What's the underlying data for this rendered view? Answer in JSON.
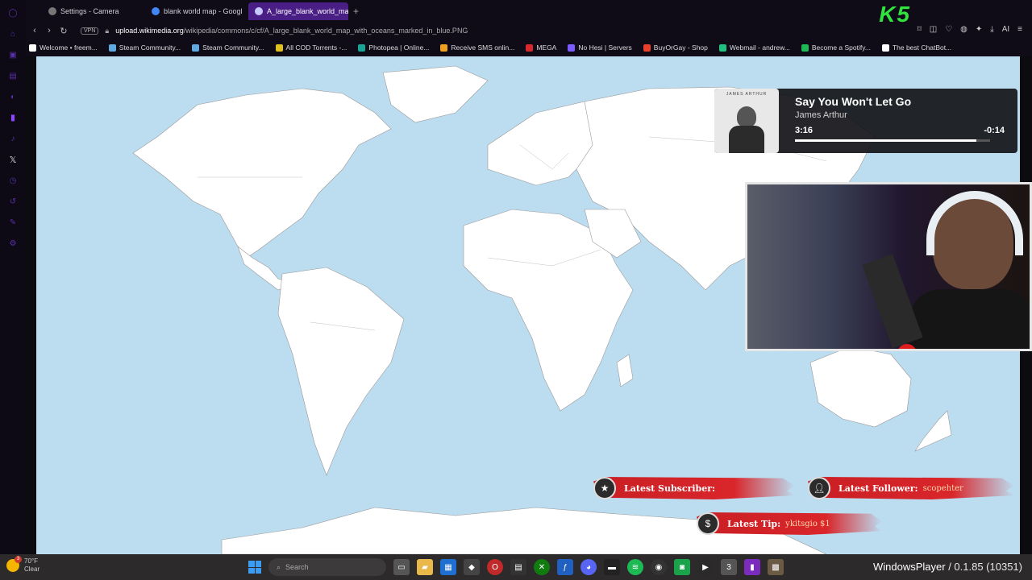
{
  "browser": {
    "tabs": [
      {
        "label": "Settings - Camera",
        "icon": "gear-icon",
        "active": false
      },
      {
        "label": "blank world map - Googl",
        "icon": "google-icon",
        "active": false
      },
      {
        "label": "A_large_blank_world_map",
        "icon": "wikimedia-icon",
        "active": true
      }
    ],
    "new_tab_symbol": "+",
    "vpn_label": "VPN",
    "url_host": "upload.wikimedia.org",
    "url_path": "/wikipedia/commons/c/cf/A_large_blank_world_map_with_oceans_marked_in_blue.PNG",
    "ai_label": "AI",
    "overlay_k5": "K5"
  },
  "bookmarks": [
    {
      "label": "Welcome • freem...",
      "color": "#ffffff"
    },
    {
      "label": "Steam Community...",
      "color": "#5fa8e0"
    },
    {
      "label": "Steam Community...",
      "color": "#5fa8e0"
    },
    {
      "label": "All COD Torrents -...",
      "color": "#e0c020"
    },
    {
      "label": "Photopea | Online...",
      "color": "#18a497"
    },
    {
      "label": "Receive SMS onlin...",
      "color": "#f0a020"
    },
    {
      "label": "MEGA",
      "color": "#d9272e"
    },
    {
      "label": "No Hesi | Servers",
      "color": "#7b5cff"
    },
    {
      "label": "BuyOrGay - Shop",
      "color": "#e8402a"
    },
    {
      "label": "Webmail - andrew...",
      "color": "#20c080"
    },
    {
      "label": "Become a Spotify...",
      "color": "#1db954"
    },
    {
      "label": "The best ChatBot...",
      "color": "#ffffff"
    }
  ],
  "now_playing": {
    "title": "Say You Won't Let Go",
    "artist": "James Arthur",
    "album_text": "JAMES ARTHUR",
    "elapsed": "3:16",
    "remaining": "-0:14",
    "progress": 0.93
  },
  "alerts": {
    "subscriber": {
      "label": "Latest Subscriber:",
      "value": ""
    },
    "follower": {
      "label": "Latest Follower:",
      "value": "scopehter"
    },
    "tip": {
      "label": "Latest Tip:",
      "value": "ykitsgio $1"
    }
  },
  "taskbar": {
    "weather_badge": "3",
    "weather_temp": "70°F",
    "weather_cond": "Clear",
    "search_placeholder": "Search",
    "right_app": "WindowsPlayer",
    "right_version": " / 0.1.85 (10351)"
  },
  "colors": {
    "ocean": "#bcdcf0",
    "land": "#ffffff",
    "alert_red": "#d9262b",
    "tab_active": "#4a1f85"
  }
}
